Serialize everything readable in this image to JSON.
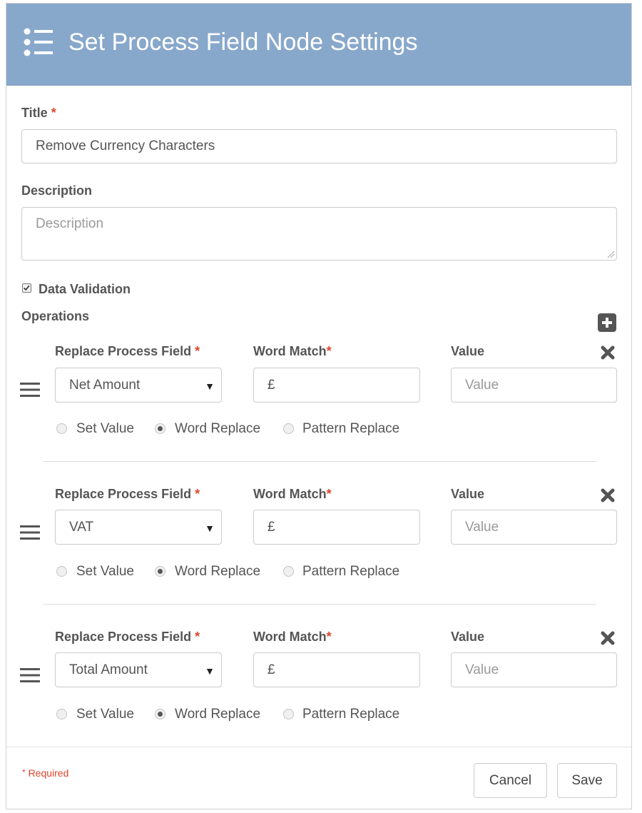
{
  "header": {
    "title": "Set Process Field Node Settings",
    "icon": "list-icon"
  },
  "form": {
    "title_label": "Title",
    "title_value": "Remove Currency Characters",
    "description_label": "Description",
    "description_placeholder": "Description",
    "data_validation_label": "Data Validation",
    "data_validation_checked": true,
    "operations_label": "Operations"
  },
  "operations": [
    {
      "field_label": "Replace Process Field",
      "field_value": "Net Amount",
      "match_label": "Word Match",
      "match_value": "£",
      "value_label": "Value",
      "value_placeholder": "Value",
      "options": [
        "Set Value",
        "Word Replace",
        "Pattern Replace"
      ],
      "selected": "Word Replace"
    },
    {
      "field_label": "Replace Process Field",
      "field_value": "VAT",
      "match_label": "Word Match",
      "match_value": "£",
      "value_label": "Value",
      "value_placeholder": "Value",
      "options": [
        "Set Value",
        "Word Replace",
        "Pattern Replace"
      ],
      "selected": "Word Replace"
    },
    {
      "field_label": "Replace Process Field",
      "field_value": "Total Amount",
      "match_label": "Word Match",
      "match_value": "£",
      "value_label": "Value",
      "value_placeholder": "Value",
      "options": [
        "Set Value",
        "Word Replace",
        "Pattern Replace"
      ],
      "selected": "Word Replace"
    }
  ],
  "footer": {
    "required_mark": "*",
    "required_note": "Required",
    "cancel_label": "Cancel",
    "save_label": "Save"
  },
  "required_asterisk": "*",
  "colors": {
    "header_bg": "#88a8cb",
    "required": "#e0452c"
  }
}
